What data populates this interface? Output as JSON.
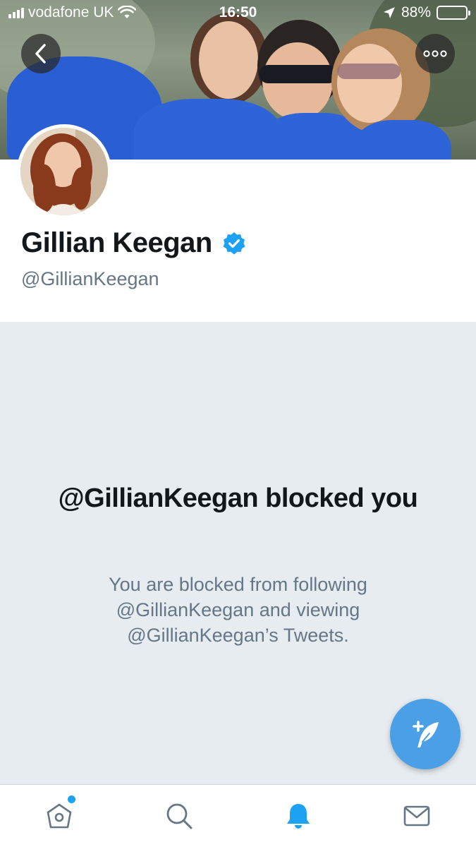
{
  "status_bar": {
    "carrier": "vodafone UK",
    "time": "16:50",
    "battery": "88%",
    "battery_level": 0.88
  },
  "profile": {
    "name": "Gillian Keegan",
    "handle": "@GillianKeegan",
    "verified": true
  },
  "blocked": {
    "title": "@GillianKeegan blocked you",
    "message": "You are blocked from following @GillianKeegan and viewing @GillianKeegan’s Tweets."
  },
  "tab_bar": {
    "items": [
      {
        "icon": "home-icon",
        "active": false,
        "has_dot": true
      },
      {
        "icon": "search-icon",
        "active": false
      },
      {
        "icon": "bell-icon",
        "active": true
      },
      {
        "icon": "mail-icon",
        "active": false
      }
    ]
  },
  "colors": {
    "accent": "#1da1f2",
    "fab": "#4a9fe7",
    "panel": "#e6ecf0",
    "text_secondary": "#657786"
  }
}
